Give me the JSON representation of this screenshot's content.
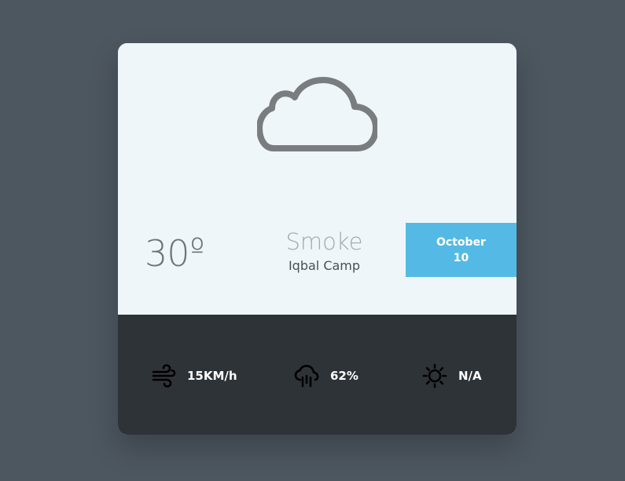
{
  "weather": {
    "temperature": "30",
    "degree_symbol": "º",
    "condition": "Smoke",
    "location": "Iqbal Camp",
    "date": {
      "month": "October",
      "day": "10"
    }
  },
  "stats": {
    "wind": "15KM/h",
    "precipitation": "62%",
    "uv": "N/A"
  },
  "icons": {
    "weather": "cloud-icon",
    "wind": "wind-icon",
    "precipitation": "rain-cloud-icon",
    "uv": "sun-icon"
  },
  "colors": {
    "page_background": "#4d5760",
    "card_top": "#eff6f9",
    "card_bottom": "#2e3337",
    "accent": "#54bae5",
    "icon_gray": "#7a7d80"
  }
}
